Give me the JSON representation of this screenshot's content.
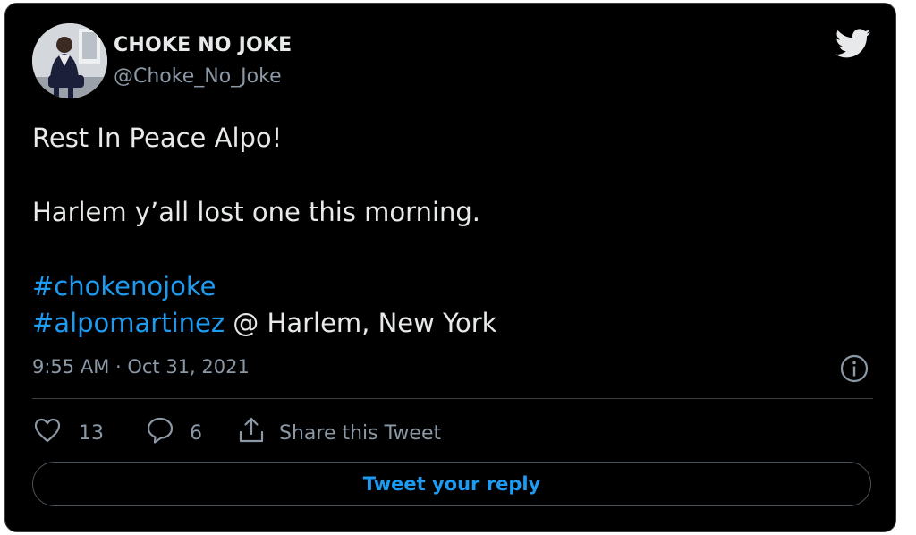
{
  "author": {
    "display_name": "CHOKE NO JOKE",
    "handle": "@Choke_No_Joke"
  },
  "tweet": {
    "line1": "Rest In Peace Alpo!",
    "line2": "Harlem y’all lost one this morning.",
    "hashtag1": "#chokenojoke",
    "hashtag2": "#alpomartinez",
    "location_suffix": " @ Harlem, New York",
    "timestamp": "9:55 AM · Oct 31, 2021"
  },
  "actions": {
    "like_count": "13",
    "reply_count": "6",
    "share_label": "Share this Tweet"
  },
  "reply_button": {
    "label": "Tweet your reply"
  },
  "icons": {
    "brand": "twitter-bird-icon",
    "info": "info-icon",
    "like": "heart-icon",
    "reply": "speech-bubble-icon",
    "share": "share-icon"
  },
  "colors": {
    "background": "#000000",
    "text": "#e7e9ea",
    "secondary": "#8b98a5",
    "accent": "#1d9bf0",
    "border": "#3a3f44"
  }
}
